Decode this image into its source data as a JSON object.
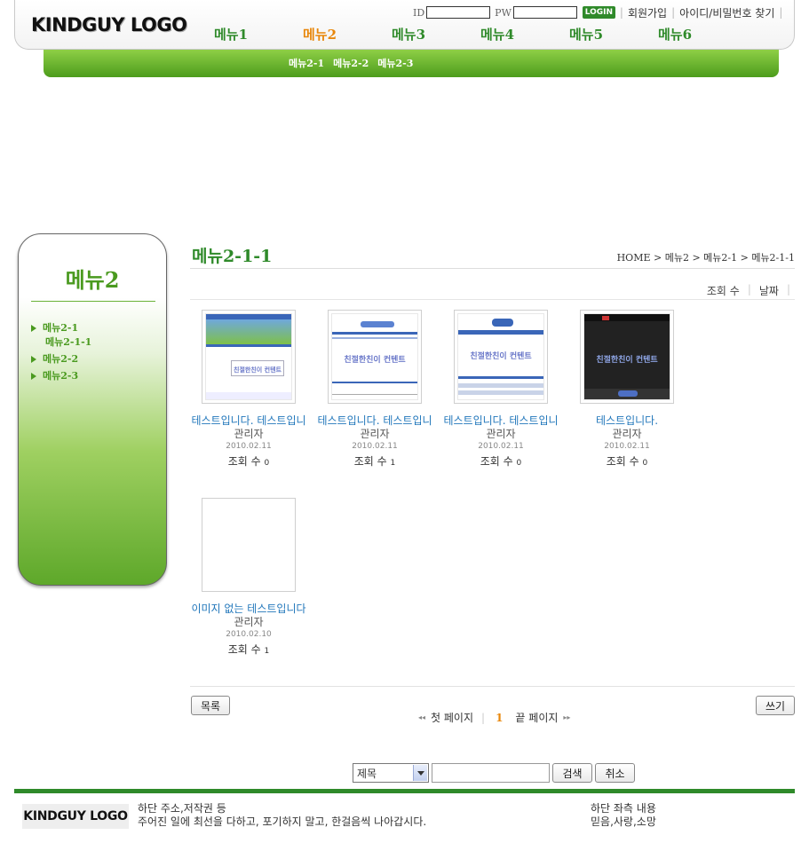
{
  "header": {
    "logo": "KINDGUY LOGO",
    "login": {
      "id_label": "ID",
      "pw_label": "PW",
      "login_button": "LOGIN",
      "join_link": "회원가입",
      "find_link": "아이디/비밀번호 찾기"
    },
    "gnb": [
      "메뉴1",
      "메뉴2",
      "메뉴3",
      "메뉴4",
      "메뉴5",
      "메뉴6"
    ],
    "gnb_active_index": 1,
    "subnav": [
      "메뉴2-1",
      "메뉴2-2",
      "메뉴2-3"
    ]
  },
  "sidebar": {
    "title": "메뉴2",
    "items": [
      {
        "label": "메뉴2-1",
        "sub": "메뉴2-1-1"
      },
      {
        "label": "메뉴2-2"
      },
      {
        "label": "메뉴2-3"
      }
    ]
  },
  "content": {
    "title": "메뉴2-1-1",
    "breadcrumb": "HOME > 메뉴2 > 메뉴2-1 > 메뉴2-1-1",
    "sort": {
      "views": "조회 수",
      "date": "날짜"
    },
    "thumbnail_text": "친절한친이 컨텐트",
    "posts": [
      {
        "title": "테스트입니다. 테스트입니",
        "author": "관리자",
        "date": "2010.02.11",
        "views_label": "조회 수",
        "views": "0"
      },
      {
        "title": "테스트입니다. 테스트입니",
        "author": "관리자",
        "date": "2010.02.11",
        "views_label": "조회 수",
        "views": "1"
      },
      {
        "title": "테스트입니다. 테스트입니",
        "author": "관리자",
        "date": "2010.02.11",
        "views_label": "조회 수",
        "views": "0"
      },
      {
        "title": "테스트입니다.",
        "author": "관리자",
        "date": "2010.02.11",
        "views_label": "조회 수",
        "views": "0"
      },
      {
        "title": "이미지 없는 테스트입니다",
        "author": "관리자",
        "date": "2010.02.10",
        "views_label": "조회 수",
        "views": "1"
      }
    ],
    "list_button": "목록",
    "write_button": "쓰기",
    "pager": {
      "first": "첫 페이지",
      "current": "1",
      "last": "끝 페이지"
    }
  },
  "search": {
    "selected": "제목",
    "input_value": "",
    "search_button": "검색",
    "cancel_button": "취소"
  },
  "footer": {
    "logo": "KINDGUY LOGO",
    "line1": "하단 주소,저작권 등",
    "line2": "주어진 일에 최선을 다하고, 포기하지 말고, 한걸음씩 나아갑시다.",
    "right1": "하단 좌측 내용",
    "right2": "믿음,사랑,소망"
  },
  "colors": {
    "brand_green": "#2f8a2a",
    "active_orange": "#e8870b",
    "link_blue": "#2277bb"
  }
}
